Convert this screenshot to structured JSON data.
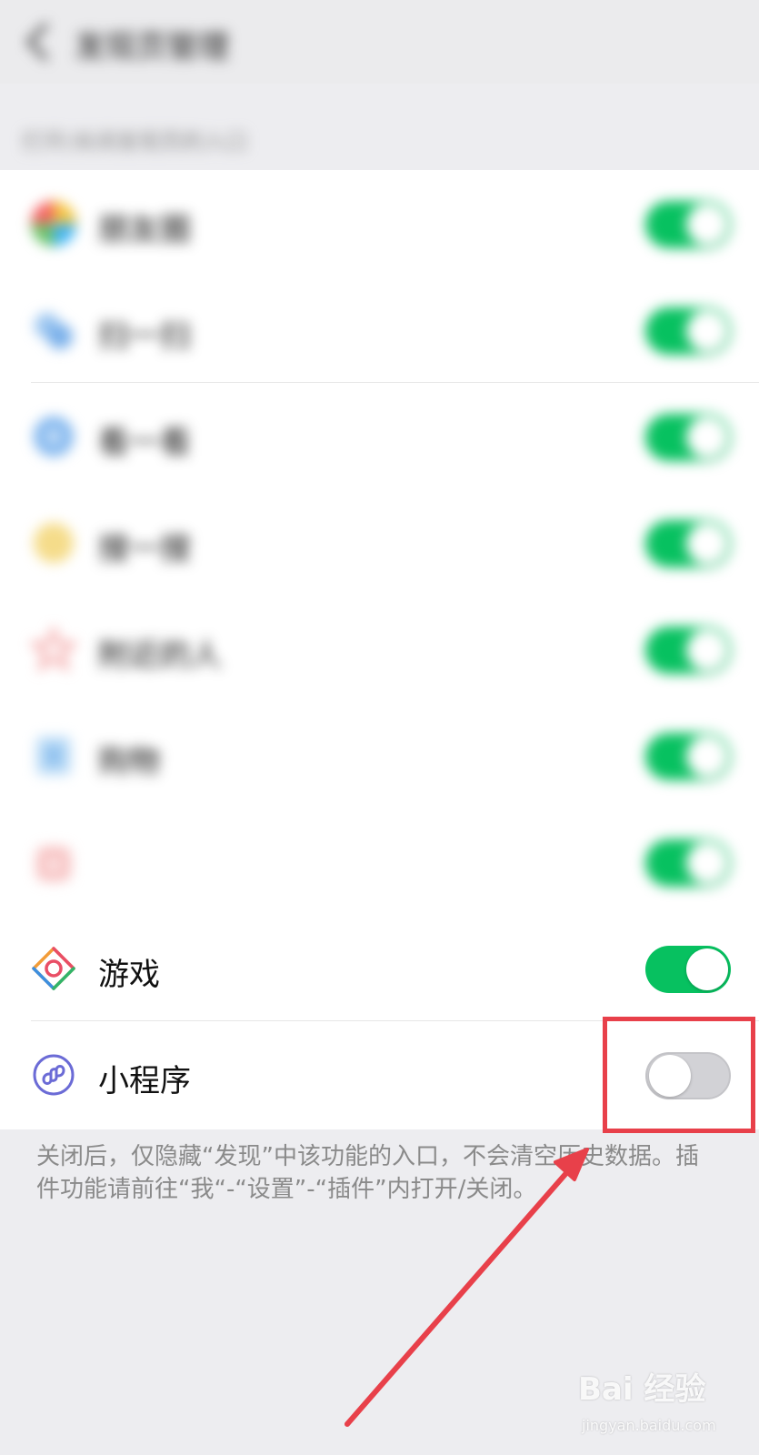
{
  "header": {
    "title": "发现页管理",
    "back_icon": "chevron-left-icon"
  },
  "section_header": "打开/关闭发现页的入口",
  "items": [
    {
      "label": "朋友圈",
      "icon": "moments-icon",
      "enabled": true,
      "blurred": true
    },
    {
      "label": "扫一扫",
      "icon": "scan-icon",
      "enabled": true,
      "blurred": true
    },
    {
      "label": "看一看",
      "icon": "top-stories-icon",
      "enabled": true,
      "blurred": true
    },
    {
      "label": "搜一搜",
      "icon": "search-icon",
      "enabled": true,
      "blurred": true
    },
    {
      "label": "附近的人",
      "icon": "nearby-icon",
      "enabled": true,
      "blurred": true
    },
    {
      "label": "购物",
      "icon": "shopping-icon",
      "enabled": true,
      "blurred": true
    },
    {
      "label": "游戏",
      "icon": "games-icon",
      "enabled": true,
      "blurred": false
    },
    {
      "label": "小程序",
      "icon": "mini-program-icon",
      "enabled": false,
      "blurred": false
    }
  ],
  "footer": "关闭后，仅隐藏“发现”中该功能的入口，不会清空历史数据。插件功能请前往“我“-“设置”-“插件”内打开/关闭。",
  "watermark": {
    "main": "Bai 经验",
    "sub": "jingyan.baidu.com"
  },
  "colors": {
    "toggle_on": "#07c160",
    "toggle_off": "#d2d2d6",
    "annotation": "#e8404a",
    "background": "#ededf0"
  }
}
